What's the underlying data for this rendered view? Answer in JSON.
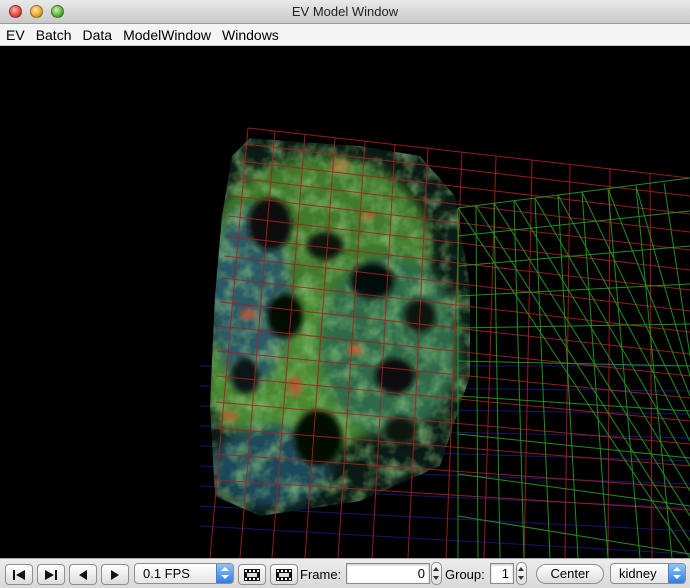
{
  "window": {
    "title": "EV Model Window"
  },
  "menu": [
    "EV",
    "Batch",
    "Data",
    "ModelWindow",
    "Windows"
  ],
  "toolbar": {
    "icons": [
      "first-frame-icon",
      "last-frame-icon",
      "step-back-icon",
      "play-icon",
      "film-icon",
      "film-icon"
    ],
    "fps_value": "0.1 FPS",
    "frame_label": "Frame:",
    "frame_value": "0",
    "group_label": "Group:",
    "group_value": "1",
    "center_label": "Center",
    "dataset_value": "kidney"
  },
  "colors": {
    "grid_red": "#b22020",
    "grid_green": "#2aa02a",
    "grid_blue": "#2020a0",
    "accent_blue": "#2f7fe5"
  }
}
